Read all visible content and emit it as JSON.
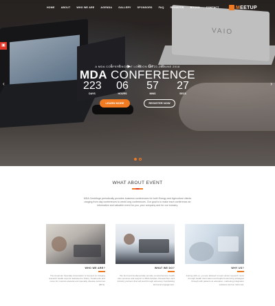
{
  "nav": {
    "items": [
      "HOME",
      "ABOUT",
      "WHO WE ARE",
      "AGENDA",
      "GALLERY",
      "SPONSORS",
      "FAQ",
      "REGISTER",
      "BOOKS",
      "CONTACT"
    ],
    "logo_prefix": "M",
    "logo_text": "EETUP"
  },
  "hero": {
    "social_icons": [
      "f",
      "t",
      "▶",
      "in",
      "G+",
      "in"
    ],
    "tagline": "A MDA CONFERENCE AT LONDON ON 22-25 JUNE 2018",
    "title_bold": "MDA",
    "title_rest": " CONFERENCE",
    "countdown": [
      {
        "value": "223",
        "label": "DAYS"
      },
      {
        "value": "06",
        "label": "HOURS"
      },
      {
        "value": "57",
        "label": "MINS"
      },
      {
        "value": "27",
        "label": "SECS"
      }
    ],
    "btn_primary": "LEARN MORE",
    "btn_secondary": "REGISTER NOW",
    "laptop_brand": "VAIO",
    "prev_arrow": "‹",
    "next_arrow": "›",
    "side_tab": "▣"
  },
  "about": {
    "title": "WHAT ABOUT EVENT",
    "intro": "MDA Centrifuge periodically provides business conferences for both Energy and Agriculture clients ranging from day conferences to week long conferences. Our goal is to make each conference an informative and valuable event for you, your company and for our industry."
  },
  "cards": [
    {
      "heading": "WHO WE ARE?",
      "text": "The American Specialty Association is focused on bringing research health experts dedicated to Policy, Treatments and cures for musculo-skeletal and specialty disease outcomes (MLS)."
    },
    {
      "heading": "WHAT WE DO?",
      "text": "We fund and fundamentally provide comprehensive health care services and support to MDA families. Researchers and Industry partners that will lead through advocacy Fundraising and local engagement."
    },
    {
      "heading": "WHY US?",
      "text": "Joining with us, you are allowed to learn about research news through health information and helpful tools living strategies through with patients at education, marketing integration solutions and an informed."
    }
  ],
  "colors": {
    "accent": "#f07a22",
    "accent_red": "#e0392b"
  }
}
